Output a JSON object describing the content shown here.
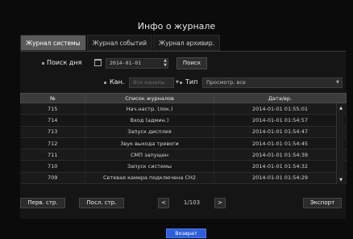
{
  "title": "Инфо о журнале",
  "tabs": [
    {
      "label": "Журнал системы",
      "active": true
    },
    {
      "label": "Журнал событий",
      "active": false
    },
    {
      "label": "Журнал архивир.",
      "active": false
    }
  ],
  "search": {
    "label": "Поиск дня",
    "date_value": "2014-01-01",
    "button": "Поиск"
  },
  "filters": {
    "channel_label": "Кан.",
    "channel_value": "Все каналы",
    "type_label": "Тип",
    "type_value": "Просмотр. все"
  },
  "table": {
    "headers": [
      "№",
      "Список журналов",
      "Дата/вр."
    ],
    "rows": [
      {
        "no": "715",
        "log": "Нач.настр. (лок.)",
        "time": "2014-01-01 01:55:01"
      },
      {
        "no": "714",
        "log": "Вход (админ.)",
        "time": "2014-01-01 01:54:57"
      },
      {
        "no": "713",
        "log": "Запуск дисплея",
        "time": "2014-01-01 01:54:47"
      },
      {
        "no": "712",
        "log": "Звук выхода тревоги",
        "time": "2014-01-01 01:54:45"
      },
      {
        "no": "711",
        "log": "СМП запущен",
        "time": "2014-01-01 01:54:39"
      },
      {
        "no": "710",
        "log": "Запуск системы",
        "time": "2014-01-01 01:54:32"
      },
      {
        "no": "709",
        "log": "Сетевая камера подключена CH2",
        "time": "2014-01-01 01:54:29"
      }
    ]
  },
  "pager": {
    "first": "Перв. стр.",
    "last": "Посл. стр.",
    "page": "1/103",
    "export": "Экспорт"
  },
  "back": "Возврат",
  "colors": {
    "accent": "#2f5fd8",
    "active_tab": "#5a5a5a"
  },
  "icons": [
    "calendar-icon",
    "spinner-up-icon",
    "spinner-down-icon",
    "dropdown-arrow-icon",
    "prev-page-icon",
    "next-page-icon",
    "scroll-up-icon",
    "scroll-down-icon"
  ]
}
